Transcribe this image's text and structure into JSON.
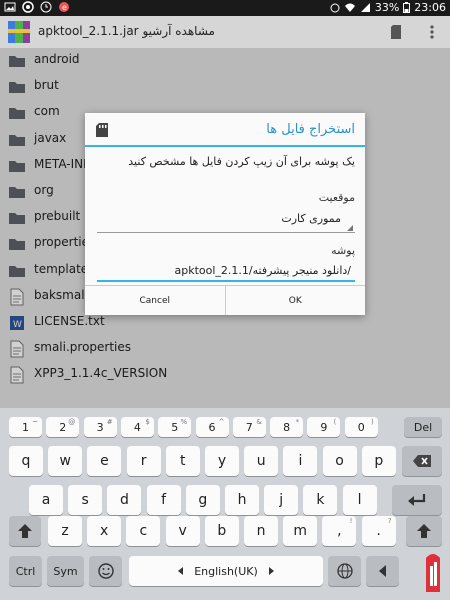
{
  "status_bar": {
    "battery": "33%",
    "time": "23:06"
  },
  "action_bar": {
    "title": "مشاهده آرشیو apktool_2.1.1.jar"
  },
  "files": [
    {
      "name": "android",
      "type": "folder"
    },
    {
      "name": "brut",
      "type": "folder"
    },
    {
      "name": "com",
      "type": "folder"
    },
    {
      "name": "javax",
      "type": "folder"
    },
    {
      "name": "META-INF",
      "type": "folder"
    },
    {
      "name": "org",
      "type": "folder"
    },
    {
      "name": "prebuilt",
      "type": "folder"
    },
    {
      "name": "properties",
      "type": "folder"
    },
    {
      "name": "templates",
      "type": "folder"
    },
    {
      "name": "baksmali.properties",
      "type": "file"
    },
    {
      "name": "LICENSE.txt",
      "type": "doc"
    },
    {
      "name": "smali.properties",
      "type": "file"
    },
    {
      "name": "XPP3_1.1.4c_VERSION",
      "type": "file"
    }
  ],
  "dialog": {
    "title": "استخراج فایل ها",
    "message": "یک پوشه برای آن زیپ کردن فایل ها مشخص کنید",
    "location_label": "موقعیت",
    "location_value": "مموری کارت",
    "folder_label": "پوشه",
    "folder_value": "/دانلود منیجر پیشرفته/apktool_2.1.1",
    "cancel_label": "Cancel",
    "ok_label": "OK"
  },
  "keyboard": {
    "number_row": [
      {
        "main": "1",
        "sub": "~"
      },
      {
        "main": "2",
        "sub": "@"
      },
      {
        "main": "3",
        "sub": "#"
      },
      {
        "main": "4",
        "sub": "$"
      },
      {
        "main": "5",
        "sub": "%"
      },
      {
        "main": "6",
        "sub": "^"
      },
      {
        "main": "7",
        "sub": "&"
      },
      {
        "main": "8",
        "sub": "*"
      },
      {
        "main": "9",
        "sub": "("
      },
      {
        "main": "0",
        "sub": ")"
      }
    ],
    "del_label": "Del",
    "row1": [
      "q",
      "w",
      "e",
      "r",
      "t",
      "y",
      "u",
      "i",
      "o",
      "p"
    ],
    "row2": [
      "a",
      "s",
      "d",
      "f",
      "g",
      "h",
      "j",
      "k",
      "l"
    ],
    "row3": [
      "z",
      "x",
      "c",
      "v",
      "b",
      "n",
      "m"
    ],
    "row3_subs": [
      "",
      "",
      "",
      "",
      "",
      "",
      ""
    ],
    "comma_key": {
      "main": ",",
      "sub": "!"
    },
    "period_key": {
      "main": ".",
      "sub": "?"
    },
    "ctrl_label": "Ctrl",
    "sym_label": "Sym",
    "space_label": "English(UK)",
    "colors": {
      "accent": "#33b5e5",
      "title": "#2a93c8"
    }
  }
}
